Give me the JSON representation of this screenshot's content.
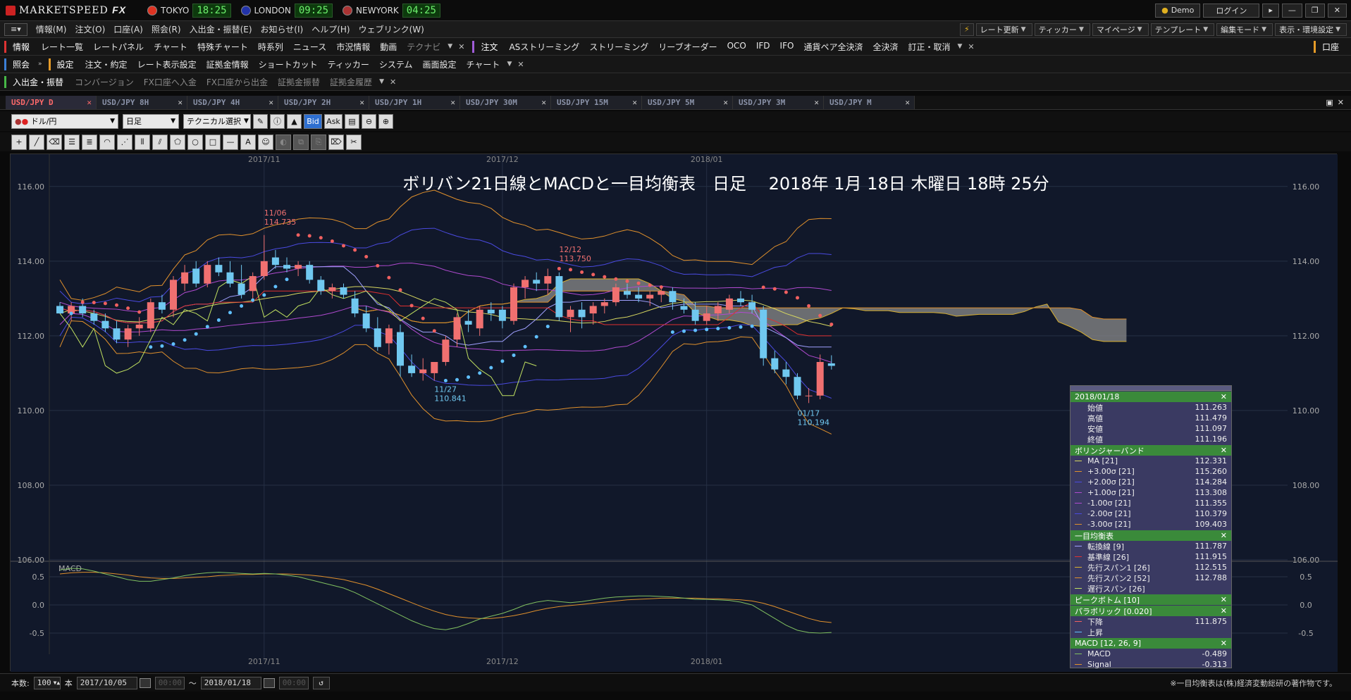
{
  "app": {
    "logo": "MARKETSPEED",
    "logo_suffix": "FX",
    "demo": "Demo",
    "login": "ログイン"
  },
  "clocks": [
    {
      "city": "TOKYO",
      "time": "18:25",
      "flag": "#d32"
    },
    {
      "city": "LONDON",
      "time": "09:25",
      "flag": "#23a"
    },
    {
      "city": "NEWYORK",
      "time": "04:25",
      "flag": "#a33"
    }
  ],
  "menu": [
    "情報(M)",
    "注文(O)",
    "口座(A)",
    "照会(R)",
    "入出金・振替(E)",
    "お知らせ(I)",
    "ヘルプ(H)",
    "ウェブリンク(W)"
  ],
  "menu_right": [
    "レート更新",
    "ティッカー",
    "マイページ",
    "テンプレート",
    "編集モード",
    "表示・環境設定"
  ],
  "tb1": {
    "head1": "情報",
    "items1": [
      "レート一覧",
      "レートパネル",
      "チャート",
      "特殊チャート",
      "時系列",
      "ニュース",
      "市況情報",
      "動画"
    ],
    "dim1": "テクナビ",
    "head2": "注文",
    "items2": [
      "ASストリーミング",
      "ストリーミング",
      "リーブオーダー",
      "OCO",
      "IFD",
      "IFO",
      "通貨ペア全決済",
      "全決済",
      "訂正・取消"
    ],
    "right": "口座"
  },
  "tb2": {
    "head1": "照会",
    "head2": "設定",
    "items2": [
      "注文・約定",
      "レート表示設定",
      "証拠金情報",
      "ショートカット",
      "ティッカー",
      "システム",
      "画面設定",
      "チャート"
    ]
  },
  "tb3": {
    "head": "入出金・振替",
    "dim": [
      "コンバージョン",
      "FX口座へ入金",
      "FX口座から出金",
      "証拠金振替",
      "証拠金履歴"
    ]
  },
  "tabs": [
    "USD/JPY D",
    "USD/JPY 8H",
    "USD/JPY 4H",
    "USD/JPY 2H",
    "USD/JPY 1H",
    "USD/JPY 30M",
    "USD/JPY 15M",
    "USD/JPY 5M",
    "USD/JPY 3M",
    "USD/JPY M"
  ],
  "controls": {
    "pair": "ドル/円",
    "period": "日足",
    "tech": "テクニカル選択",
    "bid": "Bid",
    "ask": "Ask"
  },
  "chart_title": "ボリバン21日線とMACDと一目均衡表　日足　 2018年 1月 18日 木曜日 18時 25分",
  "chart_data": {
    "type": "line",
    "symbol": "USD/JPY",
    "x_labels": [
      "2017/11",
      "2017/12",
      "2018/01"
    ],
    "y_ticks": [
      "116.00",
      "114.00",
      "112.00",
      "110.00",
      "108.00",
      "106.00"
    ],
    "ylim": [
      106,
      116.6
    ],
    "macd_label": "MACD",
    "macd_ticks": [
      "0.5",
      "0.0",
      "-0.5"
    ],
    "macd_ylim": [
      -0.75,
      0.75
    ],
    "annotations": [
      {
        "date": "11/06",
        "price": "114.735",
        "v": 114.735,
        "i": 18,
        "kind": "high"
      },
      {
        "date": "11/27",
        "price": "110.841",
        "v": 110.841,
        "i": 33,
        "kind": "low"
      },
      {
        "date": "12/12",
        "price": "113.750",
        "v": 113.75,
        "i": 44,
        "kind": "high"
      },
      {
        "date": "01/17",
        "price": "110.194",
        "v": 110.194,
        "i": 65,
        "kind": "low"
      }
    ],
    "candles": [
      [
        112.8,
        112.9,
        112.6,
        112.6
      ],
      [
        112.6,
        112.9,
        112.4,
        112.8
      ],
      [
        112.8,
        113.0,
        112.5,
        112.6
      ],
      [
        112.6,
        112.7,
        112.3,
        112.4
      ],
      [
        112.4,
        112.6,
        112.1,
        112.2
      ],
      [
        112.2,
        112.4,
        111.8,
        111.9
      ],
      [
        111.9,
        112.3,
        111.7,
        112.2
      ],
      [
        112.2,
        112.5,
        112.0,
        112.3
      ],
      [
        112.2,
        113.0,
        112.1,
        112.9
      ],
      [
        112.9,
        113.1,
        112.6,
        112.7
      ],
      [
        112.7,
        113.6,
        112.5,
        113.5
      ],
      [
        113.4,
        113.9,
        113.2,
        113.7
      ],
      [
        113.8,
        114.0,
        113.3,
        113.4
      ],
      [
        113.4,
        114.0,
        113.3,
        113.9
      ],
      [
        113.9,
        114.1,
        113.6,
        113.7
      ],
      [
        113.7,
        114.0,
        113.3,
        113.4
      ],
      [
        113.4,
        113.9,
        113.0,
        113.1
      ],
      [
        113.2,
        113.7,
        113.0,
        113.6
      ],
      [
        113.6,
        114.7,
        113.5,
        114.0
      ],
      [
        114.1,
        114.3,
        113.8,
        113.9
      ],
      [
        113.9,
        114.1,
        113.7,
        113.8
      ],
      [
        113.8,
        114.0,
        113.6,
        113.9
      ],
      [
        113.9,
        114.0,
        113.4,
        113.5
      ],
      [
        113.5,
        113.6,
        113.1,
        113.2
      ],
      [
        113.2,
        113.4,
        113.0,
        113.3
      ],
      [
        113.3,
        113.4,
        113.0,
        113.1
      ],
      [
        113.0,
        113.2,
        112.5,
        112.6
      ],
      [
        112.6,
        112.8,
        112.1,
        112.2
      ],
      [
        112.2,
        112.5,
        111.6,
        111.7
      ],
      [
        111.8,
        112.3,
        111.5,
        112.2
      ],
      [
        112.1,
        112.3,
        110.9,
        111.2
      ],
      [
        111.2,
        111.5,
        110.9,
        111.0
      ],
      [
        111.0,
        111.4,
        110.8,
        111.1
      ],
      [
        111.0,
        111.3,
        110.8,
        111.3
      ],
      [
        111.3,
        112.0,
        111.2,
        111.9
      ],
      [
        111.9,
        112.6,
        111.7,
        112.5
      ],
      [
        112.4,
        112.7,
        112.1,
        112.3
      ],
      [
        112.2,
        112.8,
        112.0,
        112.7
      ],
      [
        112.7,
        112.9,
        112.4,
        112.6
      ],
      [
        112.7,
        112.8,
        112.2,
        112.4
      ],
      [
        112.4,
        113.4,
        112.3,
        113.3
      ],
      [
        113.3,
        113.6,
        113.0,
        113.5
      ],
      [
        113.5,
        113.7,
        113.2,
        113.4
      ],
      [
        113.4,
        113.8,
        113.1,
        113.6
      ],
      [
        113.6,
        113.7,
        112.4,
        112.5
      ],
      [
        112.5,
        112.8,
        112.1,
        112.7
      ],
      [
        112.7,
        112.9,
        112.2,
        112.5
      ],
      [
        112.6,
        112.9,
        112.3,
        112.8
      ],
      [
        112.8,
        113.0,
        112.6,
        112.9
      ],
      [
        112.9,
        113.4,
        112.8,
        113.3
      ],
      [
        113.2,
        113.4,
        113.0,
        113.1
      ],
      [
        113.1,
        113.3,
        112.9,
        113.0
      ],
      [
        113.0,
        113.2,
        112.8,
        113.1
      ],
      [
        113.1,
        113.3,
        112.9,
        113.2
      ],
      [
        113.2,
        113.3,
        112.7,
        112.9
      ],
      [
        112.8,
        113.0,
        112.6,
        112.7
      ],
      [
        112.7,
        112.9,
        112.3,
        112.4
      ],
      [
        112.4,
        112.8,
        112.3,
        112.6
      ],
      [
        112.6,
        112.9,
        112.4,
        112.8
      ],
      [
        112.7,
        113.1,
        112.6,
        113.0
      ],
      [
        113.0,
        113.2,
        112.8,
        112.9
      ],
      [
        112.9,
        113.1,
        112.6,
        112.7
      ],
      [
        112.7,
        112.8,
        111.2,
        111.4
      ],
      [
        111.4,
        111.6,
        111.0,
        111.1
      ],
      [
        111.1,
        111.3,
        110.7,
        110.9
      ],
      [
        110.9,
        111.0,
        110.3,
        110.4
      ],
      [
        110.4,
        110.6,
        110.2,
        110.4
      ],
      [
        110.4,
        111.5,
        110.3,
        111.3
      ],
      [
        111.263,
        111.479,
        111.097,
        111.196
      ]
    ],
    "macd": [
      0.62,
      0.65,
      0.64,
      0.6,
      0.55,
      0.5,
      0.45,
      0.42,
      0.42,
      0.45,
      0.48,
      0.52,
      0.55,
      0.57,
      0.58,
      0.57,
      0.56,
      0.55,
      0.56,
      0.55,
      0.53,
      0.5,
      0.45,
      0.4,
      0.35,
      0.3,
      0.22,
      0.12,
      0.02,
      -0.08,
      -0.18,
      -0.28,
      -0.36,
      -0.42,
      -0.44,
      -0.4,
      -0.33,
      -0.25,
      -0.2,
      -0.15,
      -0.08,
      0.0,
      0.05,
      0.08,
      0.06,
      0.04,
      0.06,
      0.09,
      0.12,
      0.14,
      0.15,
      0.16,
      0.16,
      0.15,
      0.14,
      0.12,
      0.1,
      0.1,
      0.09,
      0.08,
      0.05,
      0.0,
      -0.12,
      -0.24,
      -0.36,
      -0.45,
      -0.49,
      -0.5,
      -0.489
    ],
    "signal": [
      0.55,
      0.57,
      0.58,
      0.58,
      0.57,
      0.55,
      0.53,
      0.5,
      0.48,
      0.47,
      0.47,
      0.48,
      0.49,
      0.5,
      0.52,
      0.53,
      0.54,
      0.54,
      0.55,
      0.55,
      0.55,
      0.54,
      0.53,
      0.51,
      0.48,
      0.45,
      0.4,
      0.35,
      0.28,
      0.2,
      0.12,
      0.04,
      -0.04,
      -0.11,
      -0.17,
      -0.21,
      -0.23,
      -0.24,
      -0.24,
      -0.22,
      -0.19,
      -0.15,
      -0.1,
      -0.06,
      -0.03,
      -0.01,
      0.01,
      0.03,
      0.05,
      0.07,
      0.09,
      0.1,
      0.11,
      0.12,
      0.12,
      0.12,
      0.12,
      0.11,
      0.11,
      0.1,
      0.09,
      0.07,
      0.03,
      -0.03,
      -0.1,
      -0.17,
      -0.24,
      -0.29,
      -0.313
    ]
  },
  "legend": {
    "date": "2018/01/18",
    "ohlc": [
      [
        "始値",
        "111.263"
      ],
      [
        "高値",
        "111.479"
      ],
      [
        "安値",
        "111.097"
      ],
      [
        "終値",
        "111.196"
      ]
    ],
    "bb_title": "ボリンジャーバンド",
    "bb": [
      [
        "MA [21]",
        "112.331",
        "#d8d860"
      ],
      [
        "+3.00σ [21]",
        "115.260",
        "#e0902c"
      ],
      [
        "+2.00σ [21]",
        "114.284",
        "#4a4ae0"
      ],
      [
        "+1.00σ [21]",
        "113.308",
        "#b04ad0"
      ],
      [
        "-1.00σ [21]",
        "111.355",
        "#b04ad0"
      ],
      [
        "-2.00σ [21]",
        "110.379",
        "#4a4ae0"
      ],
      [
        "-3.00σ [21]",
        "109.403",
        "#e0902c"
      ]
    ],
    "ichi_title": "一目均衡表",
    "ichi": [
      [
        "転換線 [9]",
        "111.787",
        "#a0a0ff"
      ],
      [
        "基準線 [26]",
        "111.915",
        "#e03030"
      ],
      [
        "先行スパン1 [26]",
        "112.515",
        "#d8b030"
      ],
      [
        "先行スパン2 [52]",
        "112.788",
        "#e0902c"
      ],
      [
        "遅行スパン [26]",
        "",
        "#c0e060"
      ]
    ],
    "peak_title": "ピークボトム [10]",
    "sar_title": "パラボリック [0.020]",
    "sar": [
      [
        "下降",
        "111.875",
        "#f06060"
      ],
      [
        "上昇",
        "",
        "#60c0ff"
      ]
    ],
    "macd_title": "MACD [12, 26, 9]",
    "macd": [
      [
        "MACD",
        "-0.489",
        "#80c060"
      ],
      [
        "Signal",
        "-0.313",
        "#e0902c"
      ]
    ]
  },
  "bottom": {
    "count_label": "本数:",
    "count": "100",
    "hon": "本",
    "from": "2017/10/05",
    "to": "2018/01/18",
    "tilde": "〜",
    "note": "※一目均衡表は(株)経済変動総研の著作物です。"
  },
  "colors": {
    "bg": "#11182a",
    "up": "#f07070",
    "down": "#70c8f0"
  }
}
